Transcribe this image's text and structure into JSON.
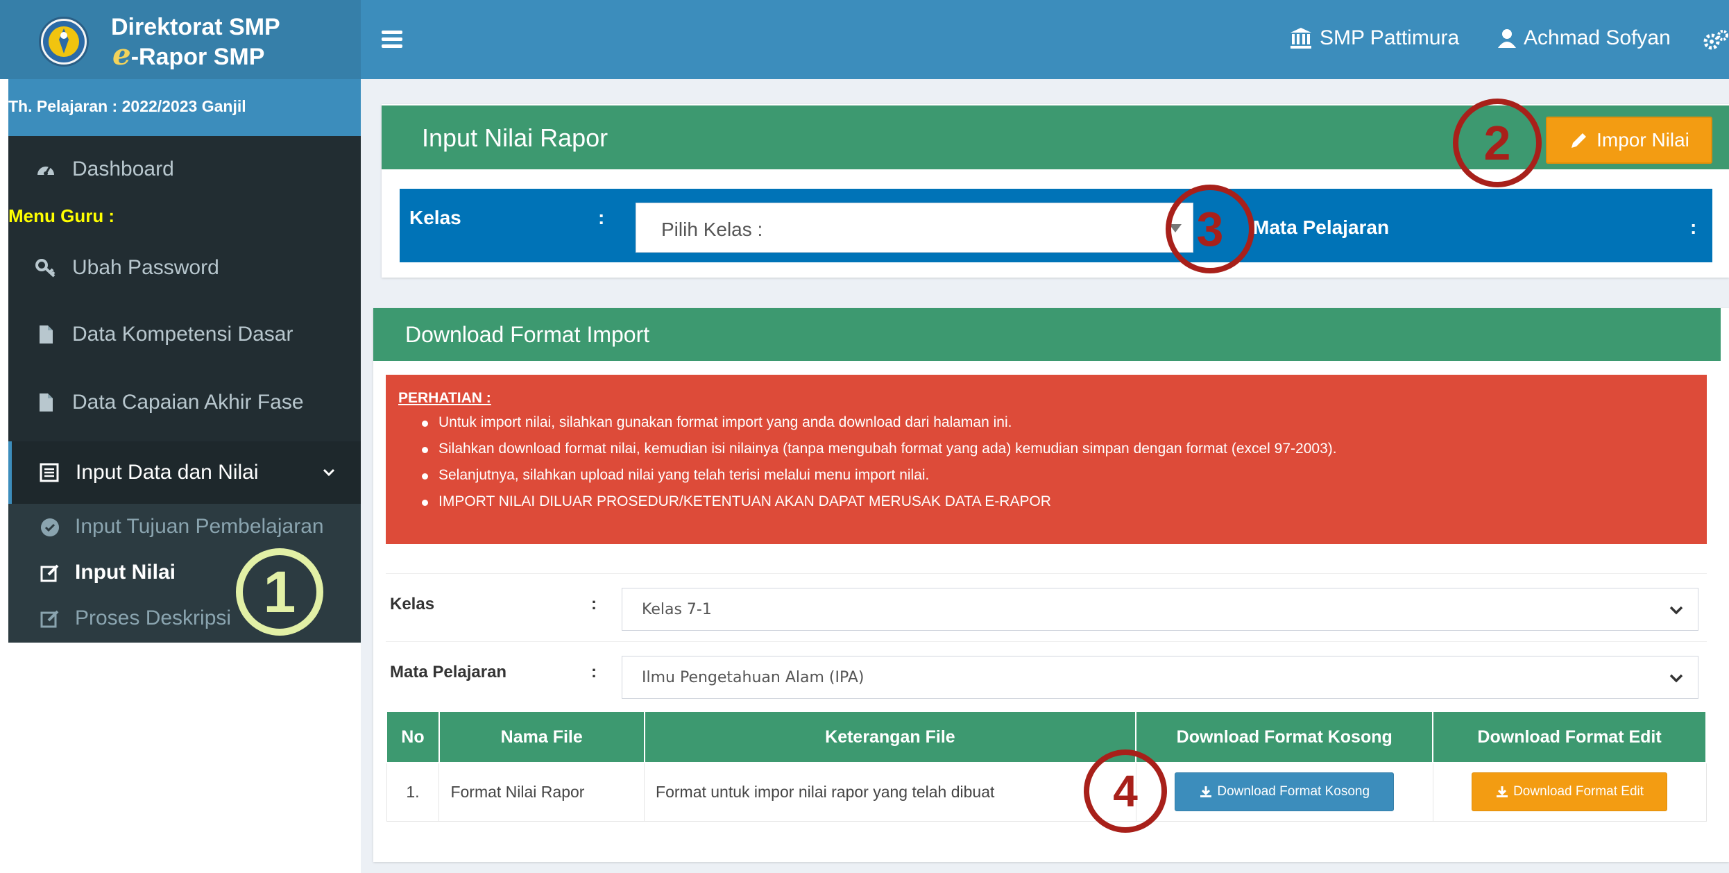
{
  "brand": {
    "line1": "Direktorat SMP",
    "line2_prefix": "e",
    "line2_rest": "-Rapor SMP"
  },
  "sidebar": {
    "year": "Th. Pelajaran : 2022/2023 Ganjil",
    "dashboard": "Dashboard",
    "menu_guru": "Menu Guru :",
    "items": [
      {
        "label": "Ubah Password",
        "icon": "key-icon"
      },
      {
        "label": "Data Kompetensi Dasar",
        "icon": "file-icon"
      },
      {
        "label": "Data Capaian Akhir Fase",
        "icon": "file-icon"
      },
      {
        "label": "Input Data dan Nilai",
        "icon": "list-icon"
      }
    ],
    "sub_items": [
      {
        "label": "Input Tujuan Pembelajaran",
        "icon": "check-circle-icon"
      },
      {
        "label": "Input Nilai",
        "icon": "edit-icon"
      },
      {
        "label": "Proses Deskripsi",
        "icon": "edit-icon"
      }
    ]
  },
  "topbar": {
    "school": "SMP Pattimura",
    "user": "Achmad Sofyan"
  },
  "input_box": {
    "title": "Input Nilai Rapor",
    "impor_button": "Impor Nilai",
    "kelas_label": "Kelas",
    "colon": ":",
    "kelas_placeholder": "Pilih Kelas :",
    "mapel_label": "Mata Pelajaran"
  },
  "download_box": {
    "title": "Download Format Import",
    "alert_title": "PERHATIAN :",
    "alert_items": [
      "Untuk import nilai, silahkan gunakan format import yang anda download dari halaman ini.",
      "Silahkan download format nilai, kemudian isi nilainya (tanpa mengubah format yang ada) kemudian simpan dengan format (excel 97-2003).",
      "Selanjutnya, silahkan upload nilai yang telah terisi melalui menu import nilai.",
      "IMPORT NILAI DILUAR PROSEDUR/KETENTUAN AKAN DAPAT MERUSAK DATA E-RAPOR"
    ],
    "kelas_label": "Kelas",
    "kelas_value": "Kelas 7-1",
    "mapel_label": "Mata Pelajaran",
    "mapel_value": "Ilmu Pengetahuan Alam (IPA)",
    "table": {
      "headers": [
        "No",
        "Nama File",
        "Keterangan File",
        "Download Format Kosong",
        "Download Format Edit"
      ],
      "rows": [
        {
          "no": "1.",
          "nama": "Format Nilai Rapor",
          "ket": "Format untuk impor nilai rapor yang telah dibuat",
          "btn_kosong": "Download Format Kosong",
          "btn_edit": "Download Format Edit"
        }
      ]
    }
  },
  "annotations": [
    "1",
    "2",
    "3",
    "4"
  ],
  "colors": {
    "primary": "#3c8dbc",
    "success": "#3d9970",
    "warning": "#f39c12",
    "danger": "#dd4b39",
    "sidebar": "#222d32",
    "annotation_red": "#a8201a",
    "annotation_green": "#e2f0a6"
  }
}
